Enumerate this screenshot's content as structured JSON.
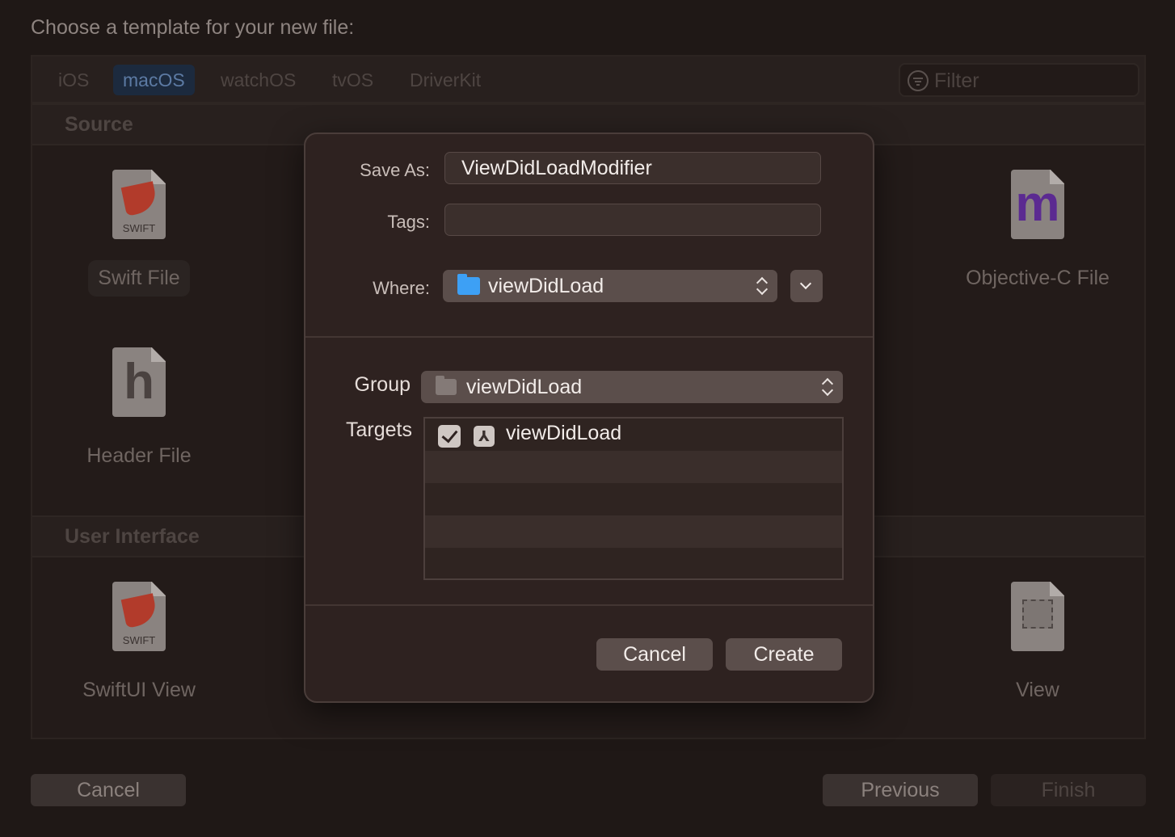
{
  "heading": "Choose a template for your new file:",
  "platforms": [
    "iOS",
    "macOS",
    "watchOS",
    "tvOS",
    "DriverKit"
  ],
  "active_platform": "macOS",
  "filter": {
    "placeholder": "Filter"
  },
  "sections": {
    "source": {
      "title": "Source",
      "tiles": {
        "swift": {
          "label": "Swift File",
          "caption": "SWIFT"
        },
        "header": {
          "label": "Header File",
          "glyph": "h"
        },
        "objc": {
          "label": "Objective-C File",
          "glyph": "m"
        }
      }
    },
    "ui": {
      "title": "User Interface",
      "tiles": {
        "swiftui": {
          "label": "SwiftUI View",
          "caption": "SWIFT"
        },
        "view": {
          "label": "View"
        }
      }
    }
  },
  "footer": {
    "cancel": "Cancel",
    "previous": "Previous",
    "finish": "Finish"
  },
  "dialog": {
    "save_as_label": "Save As:",
    "save_as_value": "ViewDidLoadModifier",
    "tags_label": "Tags:",
    "tags_value": "",
    "where_label": "Where:",
    "where_value": "viewDidLoad",
    "group_label": "Group",
    "group_value": "viewDidLoad",
    "targets_label": "Targets",
    "targets": [
      {
        "name": "viewDidLoad",
        "checked": true,
        "icon": "app-store-icon"
      }
    ],
    "cancel": "Cancel",
    "create": "Create"
  },
  "colors": {
    "accent_platform": "#1c2a3e",
    "folder": "#3da0f5",
    "swift": "#b23b2b",
    "objc": "#5b2a91"
  }
}
